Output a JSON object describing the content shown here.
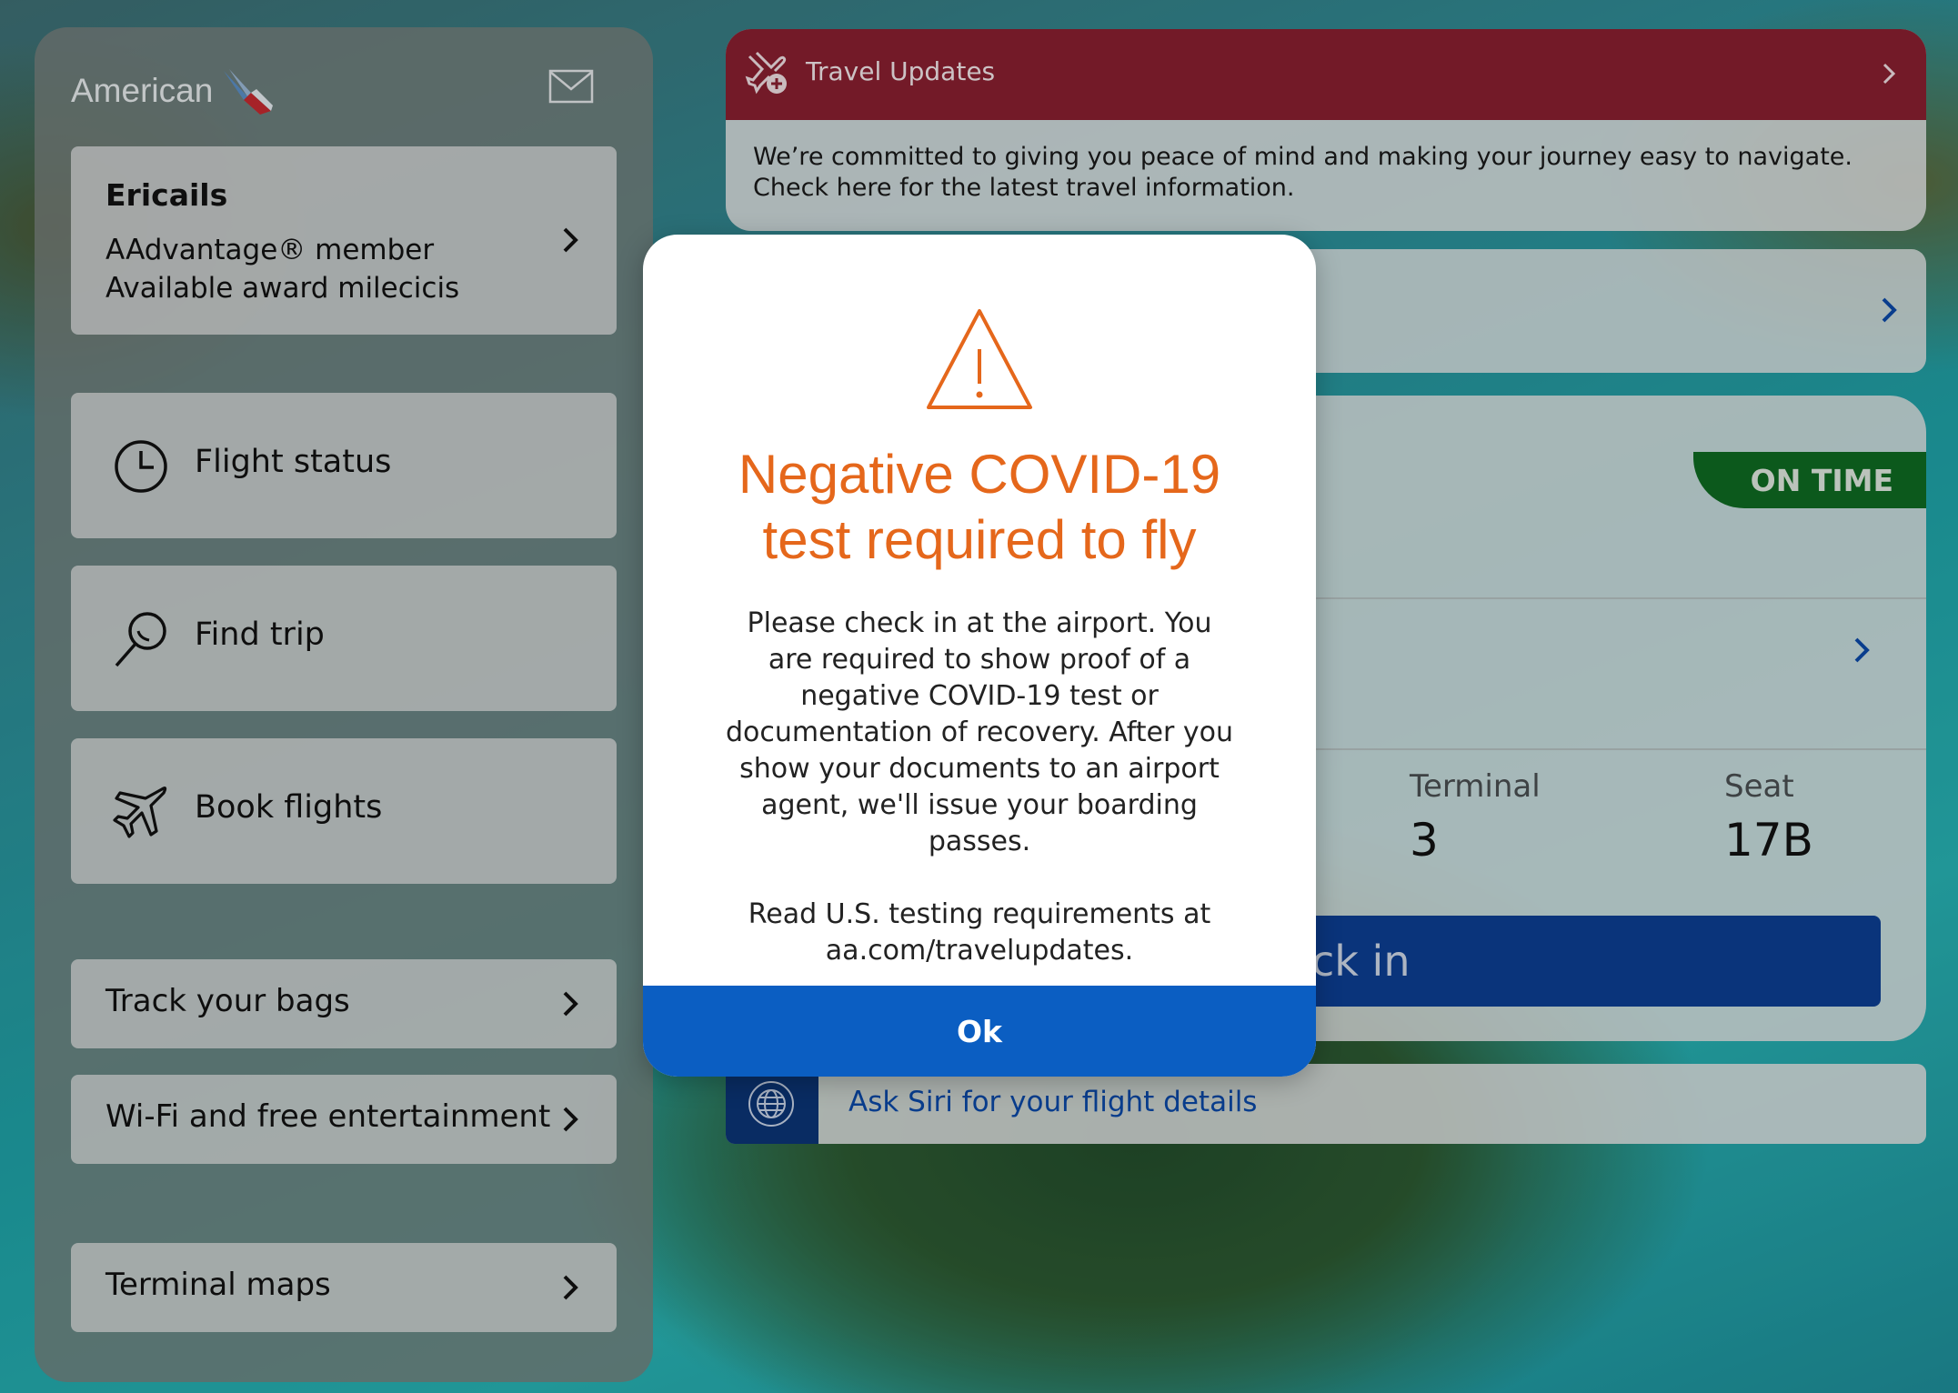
{
  "brand": {
    "name": "American"
  },
  "member": {
    "name": "Ericails",
    "status": "AAdvantage® member",
    "miles_label": "Available award milecicis"
  },
  "menu": {
    "tiles": [
      {
        "label": "Flight status",
        "icon": "clock-icon"
      },
      {
        "label": "Find trip",
        "icon": "search-icon"
      },
      {
        "label": "Book flights",
        "icon": "plane-icon"
      }
    ],
    "rows": [
      {
        "label": "Track your bags"
      },
      {
        "label": "Wi-Fi and free entertainment"
      },
      {
        "label": "Terminal maps"
      }
    ]
  },
  "travel_updates": {
    "title": "Travel Updates",
    "body": "We’re committed to giving you peace of mind and making your journey easy to navigate. Check here for the latest travel information."
  },
  "trip": {
    "status_badge": "ON TIME",
    "terminal_label": "Terminal",
    "terminal_value": "3",
    "seat_label": "Seat",
    "seat_value": "17B",
    "checkin_label_visible": "ck in"
  },
  "siri": {
    "label": "Ask Siri for your flight details"
  },
  "modal": {
    "title_line1": "Negative COVID-19",
    "title_line2": "test required to fly",
    "body_para1": "Please check in at the airport. You are required to show proof of a negative COVID-19 test or documentation of recovery. After you show your documents to an airport agent, we'll issue your boarding passes.",
    "body_para2": "Read U.S. testing requirements at aa.com/travelupdates.",
    "ok_label": "Ok"
  },
  "colors": {
    "alert_orange": "#e5671b",
    "ok_blue": "#0b5ec2",
    "updates_red": "#8a2030",
    "on_time_green": "#0f6b22",
    "checkin_blue": "#0d3f93"
  }
}
